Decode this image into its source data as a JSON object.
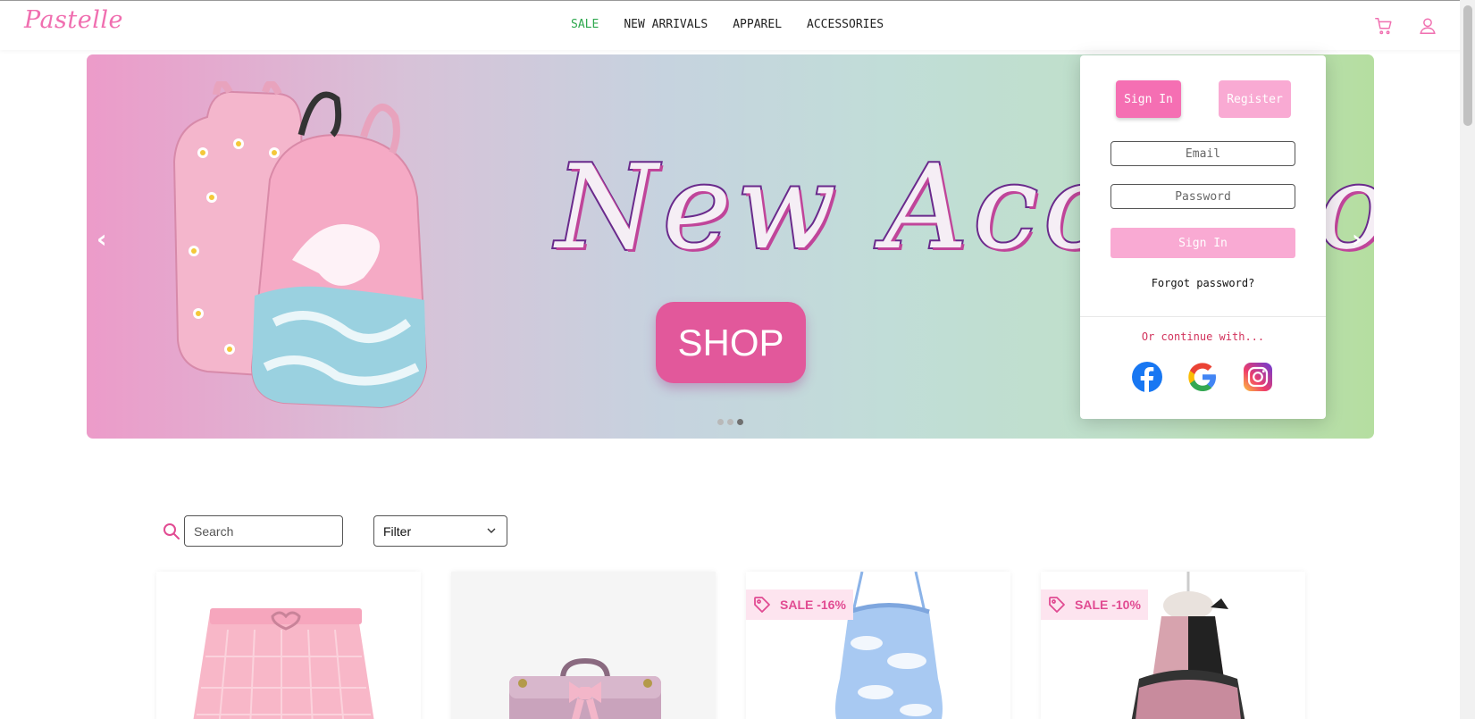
{
  "brand": {
    "logo": "Pastelle"
  },
  "nav": {
    "items": [
      "SALE",
      "NEW ARRIVALS",
      "APPAREL",
      "ACCESSORIES"
    ]
  },
  "header_icons": [
    "cart-icon",
    "user-icon"
  ],
  "colors": {
    "pink": "#f56fb3",
    "sale_green": "#2ea84e",
    "light_pink": "#f9aad3",
    "continue_red": "#d2335c"
  },
  "hero": {
    "title": "New Accessories",
    "cta": "SHOP",
    "prev": "‹",
    "next": "›",
    "slides": 3,
    "active_slide": 3
  },
  "auth": {
    "tab_signin": "Sign In",
    "tab_register": "Register",
    "email_placeholder": "Email",
    "password_placeholder": "Password",
    "submit": "Sign In",
    "forgot": "Forgot password?",
    "continue": "Or continue with...",
    "providers": [
      "facebook-icon",
      "google-icon",
      "instagram-icon"
    ]
  },
  "shop": {
    "search_placeholder": "Search",
    "filter_value": "Filter"
  },
  "products": [
    {
      "sale": ""
    },
    {
      "sale": ""
    },
    {
      "sale": "SALE -16%"
    },
    {
      "sale": "SALE -10%"
    }
  ]
}
